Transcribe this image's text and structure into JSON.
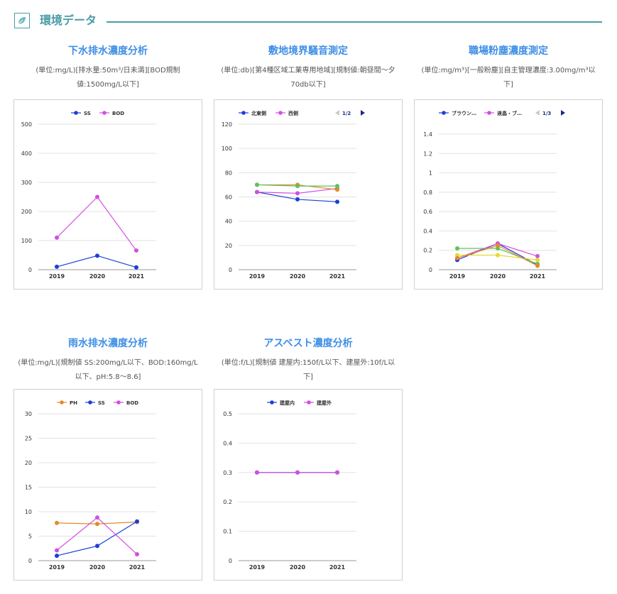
{
  "page": {
    "section_title": "環境データ",
    "icon": "leaf-icon",
    "accent_color": "#4a9ca6",
    "title_color": "#3d8ee6"
  },
  "chart_data": [
    {
      "type": "line",
      "title": "下水排水濃度分析",
      "description": "(単位:mg/L)[排水量:50m³/日未満][BOD規制値:1500mg/L以下]",
      "categories": [
        "2019",
        "2020",
        "2021"
      ],
      "ylim": [
        0,
        500
      ],
      "yticks": [
        "0",
        "100",
        "200",
        "300",
        "400",
        "500"
      ],
      "legend_position": "top",
      "series": [
        {
          "name": "SS",
          "color": "#1a3fd8",
          "values": [
            10,
            48,
            8
          ]
        },
        {
          "name": "BOD",
          "color": "#d34ee0",
          "values": [
            110,
            250,
            66
          ]
        }
      ]
    },
    {
      "type": "line",
      "title": "敷地境界騒音測定",
      "description": "(単位:db)[第4種区域工業専用地域][規制値:朝昼間〜夕70db以下]",
      "categories": [
        "2019",
        "2020",
        "2021"
      ],
      "ylim": [
        0,
        120
      ],
      "yticks": [
        "0",
        "20",
        "40",
        "60",
        "80",
        "100",
        "120"
      ],
      "legend_position": "top",
      "pager": "1/2",
      "series": [
        {
          "name": "北東側",
          "color": "#1a3fd8",
          "values": [
            64,
            58,
            56
          ],
          "legend": true
        },
        {
          "name": "西側",
          "color": "#d34ee0",
          "values": [
            64,
            63,
            67
          ],
          "legend": true
        },
        {
          "name": "",
          "color": "#e38b2c",
          "values": [
            70,
            70,
            66
          ],
          "legend": false
        },
        {
          "name": "",
          "color": "#5ec25e",
          "values": [
            70,
            69,
            69
          ],
          "legend": false
        }
      ]
    },
    {
      "type": "line",
      "title": "職場粉塵濃度測定",
      "description": "(単位:mg/m³)[一般粉塵][自主管理濃度:3.00mg/m³以下]",
      "categories": [
        "2019",
        "2020",
        "2021"
      ],
      "ylim": [
        0,
        1.4
      ],
      "yticks": [
        "0",
        "0.2",
        "0.4",
        "0.6",
        "0.8",
        "1",
        "1.2",
        "1.4"
      ],
      "legend_position": "top",
      "pager": "1/3",
      "series": [
        {
          "name": "ブラウン…",
          "color": "#1a3fd8",
          "values": [
            0.1,
            0.27,
            0.05
          ],
          "legend": true
        },
        {
          "name": "液晶・ブ…",
          "color": "#d34ee0",
          "values": [
            0.12,
            0.27,
            0.14
          ],
          "legend": true
        },
        {
          "name": "",
          "color": "#5ec25e",
          "values": [
            0.22,
            0.22,
            0.06
          ],
          "legend": false
        },
        {
          "name": "",
          "color": "#e8d830",
          "values": [
            0.15,
            0.15,
            0.1
          ],
          "legend": false
        },
        {
          "name": "",
          "color": "#e38b2c",
          "values": [
            0.12,
            0.25,
            0.04
          ],
          "legend": false
        }
      ]
    },
    {
      "type": "line",
      "title": "雨水排水濃度分析",
      "description": "(単位:mg/L)[規制値 SS:200mg/L以下、BOD:160mg/L以下、pH:5.8〜8.6]",
      "categories": [
        "2019",
        "2020",
        "2021"
      ],
      "ylim": [
        0,
        30
      ],
      "yticks": [
        "0",
        "5",
        "10",
        "15",
        "20",
        "25",
        "30"
      ],
      "legend_position": "top",
      "series": [
        {
          "name": "PH",
          "color": "#e38b2c",
          "values": [
            7.7,
            7.5,
            7.9
          ]
        },
        {
          "name": "SS",
          "color": "#1a3fd8",
          "values": [
            1.0,
            3.0,
            8.0
          ]
        },
        {
          "name": "BOD",
          "color": "#d34ee0",
          "values": [
            2.1,
            8.8,
            1.3
          ]
        }
      ]
    },
    {
      "type": "line",
      "title": "アスベスト濃度分析",
      "description": "(単位:f/L)[規制値 建屋内:150f/L以下、建屋外:10f/L以下]",
      "categories": [
        "2019",
        "2020",
        "2021"
      ],
      "ylim": [
        0,
        0.5
      ],
      "yticks": [
        "0",
        "0.1",
        "0.2",
        "0.3",
        "0.4",
        "0.5"
      ],
      "legend_position": "top",
      "series": [
        {
          "name": "建屋内",
          "color": "#1a3fd8",
          "values": [
            0.3,
            0.3,
            0.3
          ]
        },
        {
          "name": "建屋外",
          "color": "#d34ee0",
          "values": [
            0.3,
            0.3,
            0.3
          ]
        }
      ]
    }
  ]
}
